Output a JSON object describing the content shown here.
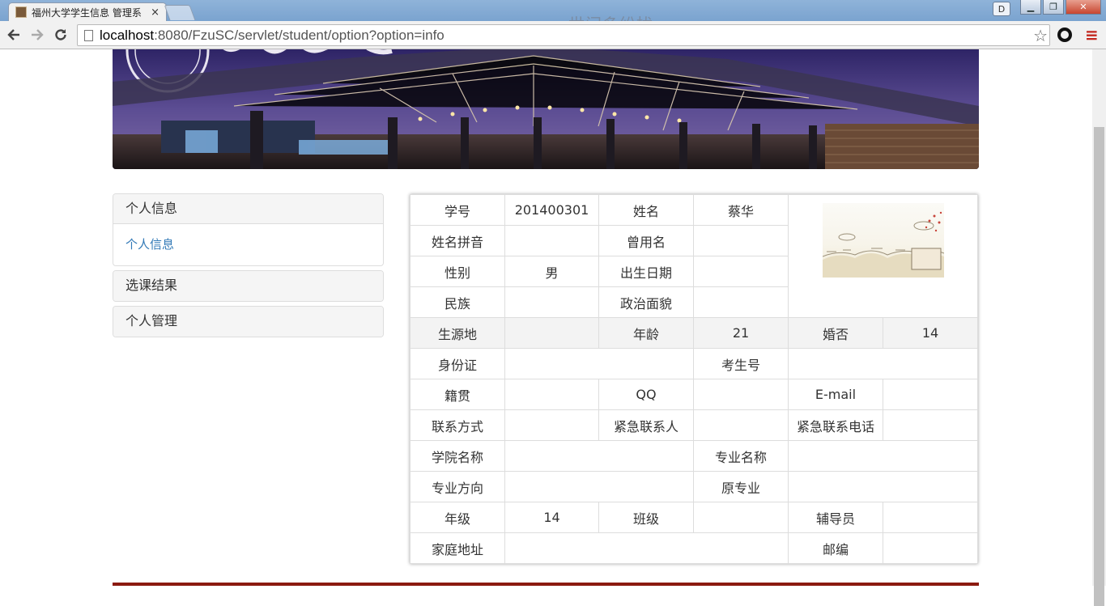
{
  "browser": {
    "tab_title": "福州大学学生信息 管理系",
    "tab_close": "×",
    "overlay_text": "世间多纷扰",
    "url_host": "localhost",
    "url_rest": ":8080/FzuSC/servlet/student/option?option=info",
    "profile_initial": "D"
  },
  "sidebar": {
    "personal_info": {
      "heading": "个人信息",
      "link": "个人信息"
    },
    "course_results": {
      "heading": "选课结果"
    },
    "personal_mgmt": {
      "heading": "个人管理"
    }
  },
  "student": {
    "labels": {
      "student_id": "学号",
      "name": "姓名",
      "name_pinyin": "姓名拼音",
      "former_name": "曾用名",
      "gender": "性别",
      "birth_date": "出生日期",
      "ethnicity": "民族",
      "political_status": "政治面貌",
      "origin": "生源地",
      "age": "年龄",
      "married": "婚否",
      "id_card": "身份证",
      "exam_no": "考生号",
      "native_place": "籍贯",
      "qq": "QQ",
      "email": "E-mail",
      "contact": "联系方式",
      "emergency_contact": "紧急联系人",
      "emergency_phone": "紧急联系电话",
      "college": "学院名称",
      "major": "专业名称",
      "major_direction": "专业方向",
      "original_major": "原专业",
      "grade": "年级",
      "class": "班级",
      "counselor": "辅导员",
      "home_address": "家庭地址",
      "postcode": "邮编"
    },
    "values": {
      "student_id": "201400301",
      "name": "蔡华",
      "name_pinyin": "",
      "former_name": "",
      "gender": "男",
      "birth_date": "",
      "ethnicity": "",
      "political_status": "",
      "origin": "",
      "age": "21",
      "married": "14",
      "id_card": "",
      "exam_no": "",
      "native_place": "",
      "qq": "",
      "email": "",
      "contact": "",
      "emergency_contact": "",
      "emergency_phone": "",
      "college": "",
      "major": "",
      "major_direction": "",
      "original_major": "",
      "grade": "14",
      "class": "",
      "counselor": "",
      "home_address": "",
      "postcode": ""
    }
  }
}
